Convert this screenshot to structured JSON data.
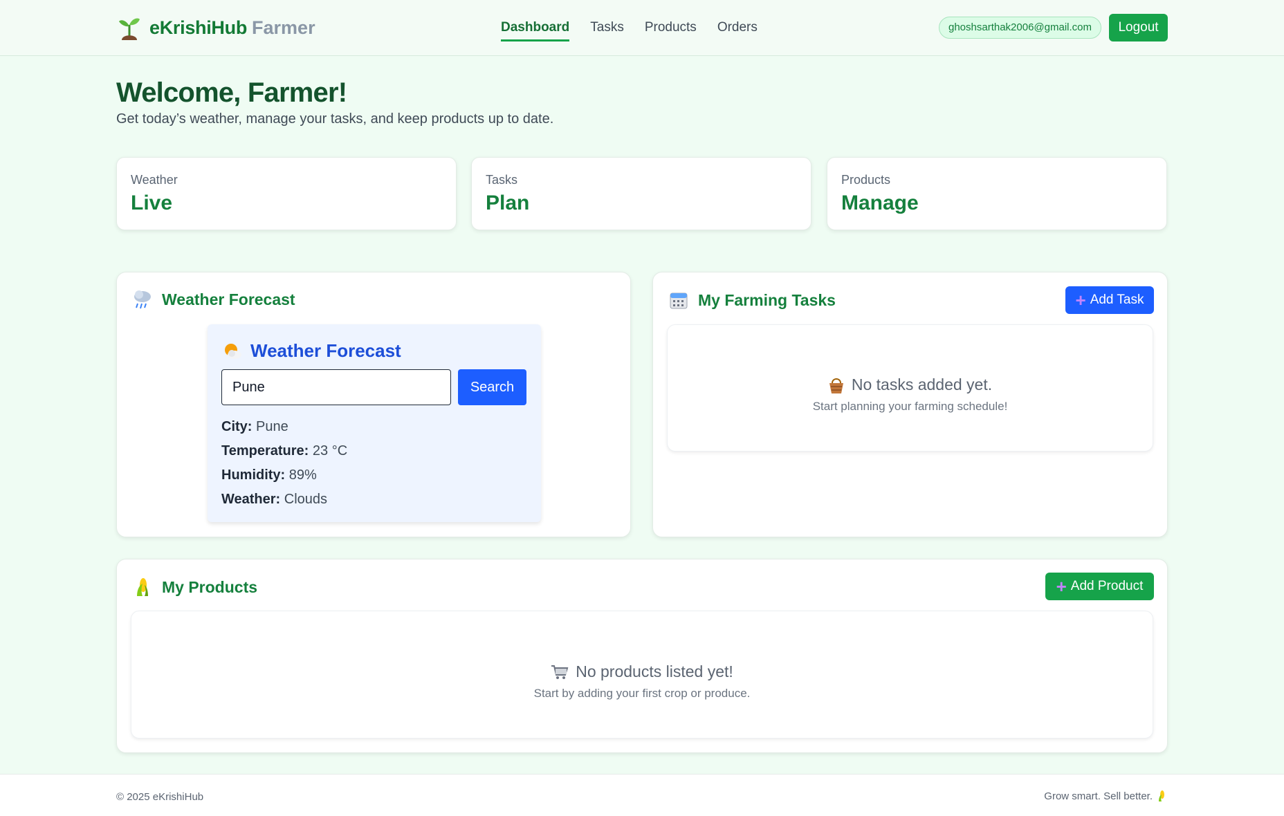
{
  "header": {
    "brand_name": "eKrishiHub",
    "brand_sub": "Farmer",
    "nav": [
      "Dashboard",
      "Tasks",
      "Products",
      "Orders"
    ],
    "active_nav": "Dashboard",
    "user_email": "ghoshsarthak2006@gmail.com",
    "logout_label": "Logout"
  },
  "welcome": {
    "title": "Welcome, Farmer!",
    "subtitle": "Get today’s weather, manage your tasks, and keep products up to date."
  },
  "stats": [
    {
      "label": "Weather",
      "value": "Live"
    },
    {
      "label": "Tasks",
      "value": "Plan"
    },
    {
      "label": "Products",
      "value": "Manage"
    }
  ],
  "weather_panel": {
    "title": "Weather Forecast",
    "icon": "rain-cloud-icon",
    "card": {
      "title": "Weather Forecast",
      "icon": "sun-cloud-icon",
      "city_input": "Pune",
      "search_label": "Search",
      "rows": [
        {
          "label": "City:",
          "value": "Pune"
        },
        {
          "label": "Temperature:",
          "value": "23 °C"
        },
        {
          "label": "Humidity:",
          "value": "89%"
        },
        {
          "label": "Weather:",
          "value": "Clouds"
        }
      ]
    }
  },
  "tasks_panel": {
    "title": "My Farming Tasks",
    "icon": "calendar-icon",
    "add_label": "Add Task",
    "empty_main": "No tasks added yet.",
    "empty_sub": "Start planning your farming schedule!",
    "empty_icon": "basket-icon"
  },
  "products_panel": {
    "title": "My Products",
    "icon": "corn-icon",
    "add_label": "Add Product",
    "empty_main": "No products listed yet!",
    "empty_sub": "Start by adding your first crop or produce.",
    "empty_icon": "cart-icon"
  },
  "footer": {
    "copyright": "© 2025 eKrishiHub",
    "tagline": "Grow smart. Sell better."
  },
  "colors": {
    "primary_green": "#16a34a",
    "accent_blue": "#1d5eff",
    "background": "#effcf3"
  }
}
